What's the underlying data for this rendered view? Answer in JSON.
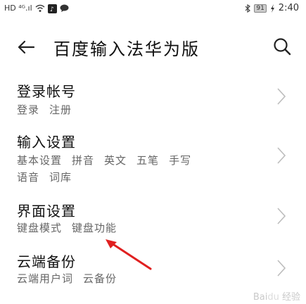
{
  "status": {
    "left": "HD ⁴ᴳ.ıl",
    "battery": "91",
    "time": "2:40"
  },
  "header": {
    "title": "百度输入法华为版"
  },
  "items": [
    {
      "title": "登录帐号",
      "subs": [
        "登录",
        "注册"
      ]
    },
    {
      "title": "输入设置",
      "subs": [
        "基本设置",
        "拼音",
        "英文",
        "五笔",
        "手写"
      ],
      "subs2": [
        "语音",
        "词库"
      ]
    },
    {
      "title": "界面设置",
      "subs": [
        "键盘模式",
        "键盘功能"
      ]
    },
    {
      "title": "云端备份",
      "subs": [
        "云端用户词",
        "云备份"
      ]
    }
  ],
  "annotation": {
    "color": "#e02020"
  }
}
